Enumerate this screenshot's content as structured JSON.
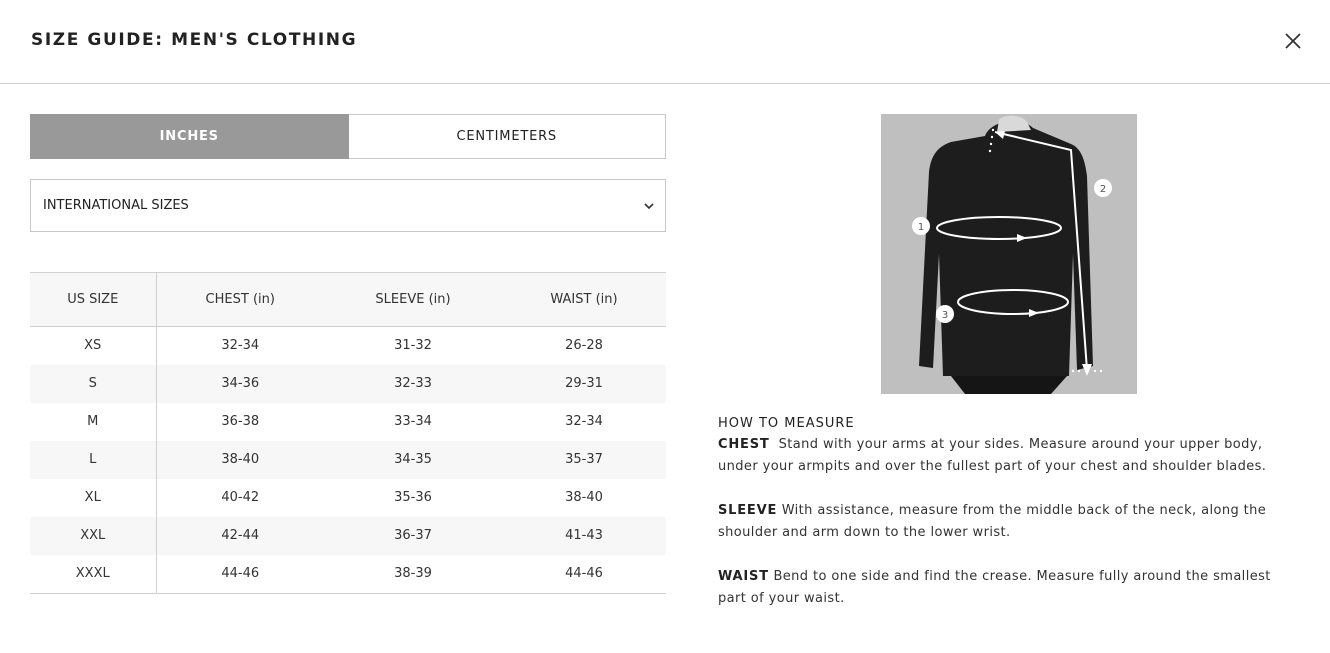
{
  "header": {
    "title": "SIZE GUIDE: MEN'S CLOTHING"
  },
  "units": {
    "inches": "INCHES",
    "centimeters": "CENTIMETERS",
    "selected": "INCHES"
  },
  "region_select": {
    "value": "INTERNATIONAL SIZES"
  },
  "table": {
    "headers": [
      "US SIZE",
      "CHEST (in)",
      "SLEEVE (in)",
      "WAIST (in)"
    ],
    "rows": [
      [
        "XS",
        "32-34",
        "31-32",
        "26-28"
      ],
      [
        "S",
        "34-36",
        "32-33",
        "29-31"
      ],
      [
        "M",
        "36-38",
        "33-34",
        "32-34"
      ],
      [
        "L",
        "38-40",
        "34-35",
        "35-37"
      ],
      [
        "XL",
        "40-42",
        "35-36",
        "38-40"
      ],
      [
        "XXL",
        "42-44",
        "36-37",
        "41-43"
      ],
      [
        "XXXL",
        "44-46",
        "38-39",
        "44-46"
      ]
    ]
  },
  "figure": {
    "markers": [
      "1",
      "2",
      "3"
    ]
  },
  "how_to": {
    "title": "HOW TO MEASURE",
    "chest": {
      "label": "CHEST",
      "text": "Stand with your arms at your sides. Measure around your upper body, under your armpits and over the fullest part of your chest and shoulder blades."
    },
    "sleeve": {
      "label": "SLEEVE",
      "text": "With assistance, measure from the middle back of the neck, along the shoulder and arm down to the lower wrist."
    },
    "waist": {
      "label": "WAIST",
      "text": "Bend to one side and find the crease. Measure fully around the smallest part of your waist."
    }
  },
  "colors": {
    "active_tab": "#999999",
    "border": "#c8c8c8",
    "row_alt": "#f7f7f7",
    "text": "#222222"
  },
  "icons": [
    "close-icon",
    "chevron-down-icon"
  ]
}
